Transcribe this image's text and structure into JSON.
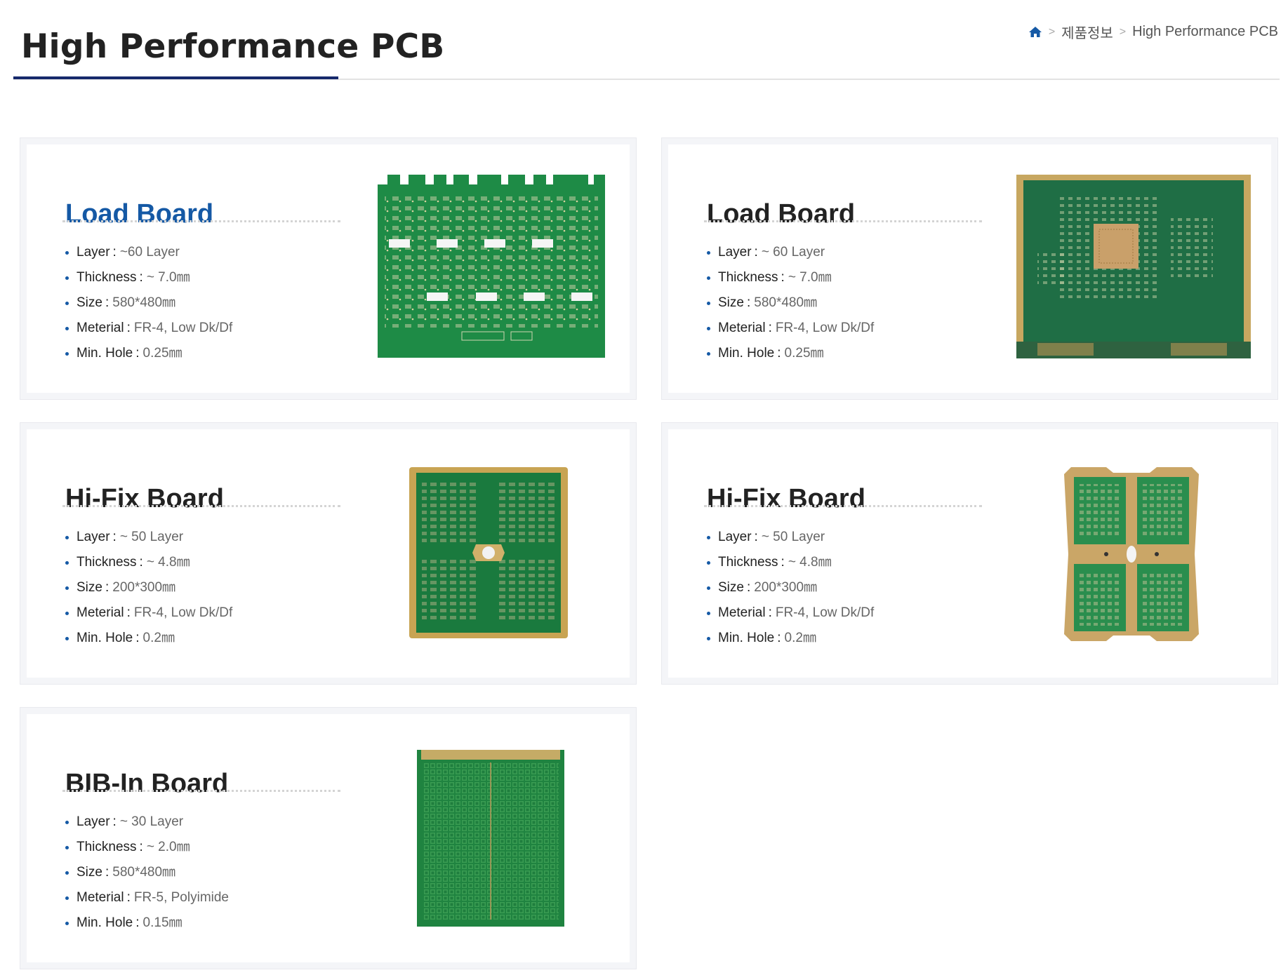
{
  "header": {
    "title": "High Performance PCB",
    "breadcrumb": [
      "제품정보",
      "High Performance PCB"
    ]
  },
  "products": [
    {
      "title": "Load Board",
      "active": true,
      "specs": [
        {
          "label": "Layer",
          "value": "~60 Layer"
        },
        {
          "label": "Thickness",
          "value": "~ 7.0㎜"
        },
        {
          "label": "Size",
          "value": "580*480㎜"
        },
        {
          "label": "Meterial",
          "value": "FR-4, Low Dk/Df"
        },
        {
          "label": "Min. Hole",
          "value": "0.25㎜"
        }
      ]
    },
    {
      "title": "Load Board",
      "active": false,
      "specs": [
        {
          "label": "Layer",
          "value": "~ 60 Layer"
        },
        {
          "label": "Thickness",
          "value": "~ 7.0㎜"
        },
        {
          "label": "Size",
          "value": "580*480㎜"
        },
        {
          "label": "Meterial",
          "value": "FR-4, Low Dk/Df"
        },
        {
          "label": "Min. Hole",
          "value": "0.25㎜"
        }
      ]
    },
    {
      "title": "Hi-Fix Board",
      "active": false,
      "specs": [
        {
          "label": "Layer",
          "value": "~ 50 Layer"
        },
        {
          "label": "Thickness",
          "value": "~ 4.8㎜"
        },
        {
          "label": "Size",
          "value": "200*300㎜"
        },
        {
          "label": "Meterial",
          "value": "FR-4, Low Dk/Df"
        },
        {
          "label": "Min. Hole",
          "value": "0.2㎜"
        }
      ]
    },
    {
      "title": "Hi-Fix Board",
      "active": false,
      "specs": [
        {
          "label": "Layer",
          "value": "~ 50 Layer"
        },
        {
          "label": "Thickness",
          "value": "~ 4.8㎜"
        },
        {
          "label": "Size",
          "value": "200*300㎜"
        },
        {
          "label": "Meterial",
          "value": "FR-4, Low Dk/Df"
        },
        {
          "label": "Min. Hole",
          "value": "0.2㎜"
        }
      ]
    },
    {
      "title": "BIB-In Board",
      "active": false,
      "specs": [
        {
          "label": "Layer",
          "value": "~ 30 Layer"
        },
        {
          "label": "Thickness",
          "value": "~ 2.0㎜"
        },
        {
          "label": "Size",
          "value": "580*480㎜"
        },
        {
          "label": "Meterial",
          "value": "FR-5, Polyimide"
        },
        {
          "label": "Min. Hole",
          "value": "0.15㎜"
        }
      ]
    }
  ],
  "colors": {
    "accent": "#1559a5",
    "title_rule": "#16296b",
    "pcb_green": "#1f8a45",
    "pcb_gold": "#c9a55a"
  },
  "icons": {
    "home": "home-icon",
    "bullet": "bullet-dot"
  }
}
